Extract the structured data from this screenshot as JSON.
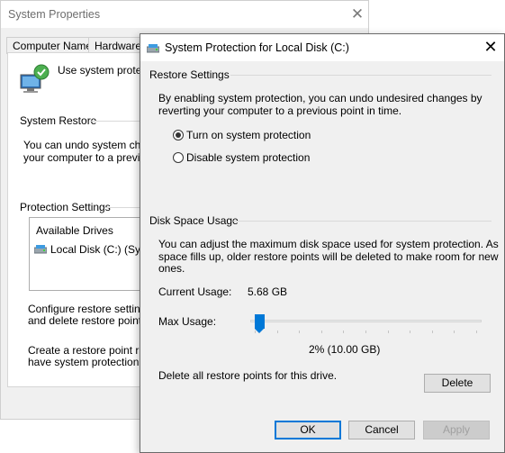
{
  "sysprops": {
    "title": "System Properties",
    "tabs": [
      "Computer Name",
      "Hardware"
    ],
    "intro": "Use system protectio",
    "system_restore_heading": "System Restore",
    "system_restore_text_1": "You can undo system chan",
    "system_restore_text_2": "your computer to a previous",
    "protection_settings_heading": "Protection Settings",
    "available_drives_header": "Available Drives",
    "drive_label": "Local Disk (C:) (Syste",
    "configure_text_1": "Configure restore settings,",
    "configure_text_2": "and delete restore points.",
    "create_text_1": "Create a restore point right",
    "create_text_2": "have system protection tur"
  },
  "dialog": {
    "title": "System Protection for Local Disk (C:)",
    "restore_settings_heading": "Restore Settings",
    "restore_desc_1": "By enabling system protection, you can undo undesired changes by",
    "restore_desc_2": "reverting your computer to a previous point in time.",
    "radio_on_label": "Turn on system protection",
    "radio_off_label": "Disable system protection",
    "selected_option": "on",
    "disk_usage_heading": "Disk Space Usage",
    "disk_desc_1": "You can adjust the maximum disk space used for system protection. As",
    "disk_desc_2": "space fills up, older restore points will be deleted to make room for new",
    "disk_desc_3": "ones.",
    "current_usage_label": "Current Usage:",
    "current_usage_value": "5.68 GB",
    "max_usage_label": "Max Usage:",
    "max_usage_value": "2% (10.00 GB)",
    "max_usage_percent": 2,
    "delete_text": "Delete all restore points for this drive.",
    "delete_button": "Delete",
    "ok_button": "OK",
    "cancel_button": "Cancel",
    "apply_button": "Apply"
  },
  "colors": {
    "accent": "#0078d7",
    "window_bg": "#f0f0f0"
  }
}
